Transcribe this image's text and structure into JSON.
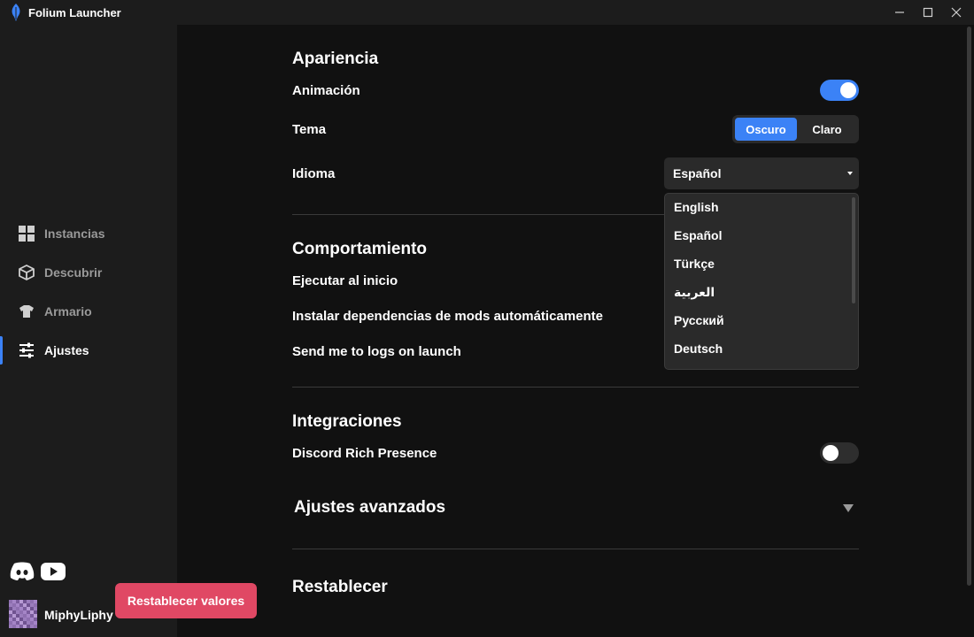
{
  "window": {
    "title": "Folium Launcher"
  },
  "colors": {
    "accent": "#3b82f6",
    "danger": "#e04864",
    "background": "#111111",
    "sidebar": "#1c1c1c"
  },
  "sidebar": {
    "items": [
      {
        "label": "Instancias",
        "icon": "grid-icon",
        "active": false
      },
      {
        "label": "Descubrir",
        "icon": "cube-icon",
        "active": false
      },
      {
        "label": "Armario",
        "icon": "shirt-icon",
        "active": false
      },
      {
        "label": "Ajustes",
        "icon": "sliders-icon",
        "active": true
      }
    ],
    "social": [
      "discord-icon",
      "youtube-icon"
    ],
    "user": {
      "name": "MiphyLiphy"
    }
  },
  "appearance": {
    "title": "Apariencia",
    "animation_label": "Animación",
    "animation_on": true,
    "theme_label": "Tema",
    "theme_options": [
      "Oscuro",
      "Claro"
    ],
    "theme_selected": "Oscuro",
    "language_label": "Idioma",
    "language_selected": "Español",
    "language_options": [
      "English",
      "Español",
      "Türkçe",
      "العربية",
      "Русский",
      "Deutsch"
    ]
  },
  "behavior": {
    "title": "Comportamiento",
    "run_at_start_label": "Ejecutar al inicio",
    "install_deps_label": "Instalar dependencias de mods automáticamente",
    "logs_label": "Send me to logs on launch"
  },
  "integrations": {
    "title": "Integraciones",
    "discord_label": "Discord Rich Presence",
    "discord_on": false
  },
  "advanced": {
    "title": "Ajustes avanzados"
  },
  "reset": {
    "title": "Restablecer",
    "button_label": "Restablecer valores"
  }
}
